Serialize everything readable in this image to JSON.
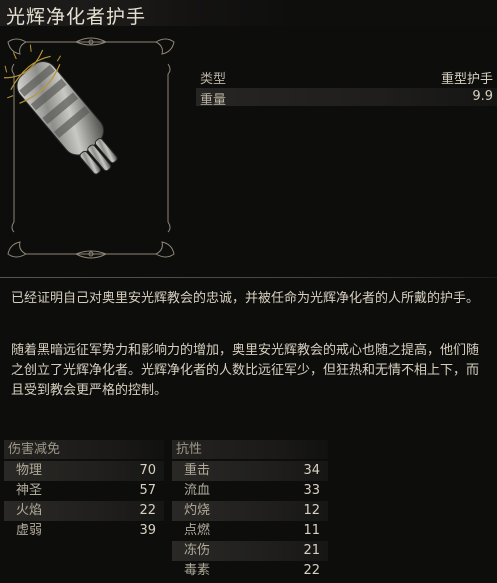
{
  "item": {
    "name": "光辉净化者护手",
    "type_label": "类型",
    "type_value": "重型护手",
    "weight_label": "重量",
    "weight_value": "9.9"
  },
  "description": {
    "p1": "已经证明自己对奥里安光辉教会的忠诚，并被任命为光辉净化者的人所戴的护手。",
    "p2": "随着黑暗远征军势力和影响力的增加，奥里安光辉教会的戒心也随之提高，他们随之创立了光辉净化者。光辉净化者的人数比远征军少，但狂热和无情不相上下，而且受到教会更严格的控制。"
  },
  "damage_negation": {
    "title": "伤害减免",
    "rows": [
      {
        "label": "物理",
        "value": "70"
      },
      {
        "label": "神圣",
        "value": "57"
      },
      {
        "label": "火焰",
        "value": "22"
      },
      {
        "label": "虚弱",
        "value": "39"
      }
    ]
  },
  "resistance": {
    "title": "抗性",
    "rows": [
      {
        "label": "重击",
        "value": "34"
      },
      {
        "label": "流血",
        "value": "33"
      },
      {
        "label": "灼烧",
        "value": "12"
      },
      {
        "label": "点燃",
        "value": "11"
      },
      {
        "label": "冻伤",
        "value": "21"
      },
      {
        "label": "毒素",
        "value": "22"
      }
    ]
  }
}
